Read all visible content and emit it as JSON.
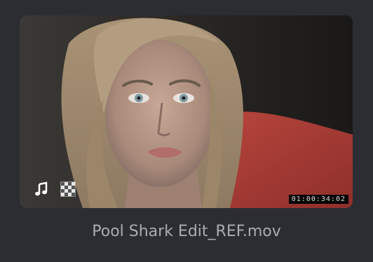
{
  "clip": {
    "filename": "Pool Shark Edit_REF.mov",
    "timecode": "01:00:34:02",
    "badges": [
      {
        "icon": "music-note-icon"
      },
      {
        "icon": "checkerboard-alpha-icon"
      }
    ]
  },
  "colors": {
    "panel": "#2b2d32",
    "filename_text": "#a9acb3",
    "timecode_bg": "#050505"
  }
}
